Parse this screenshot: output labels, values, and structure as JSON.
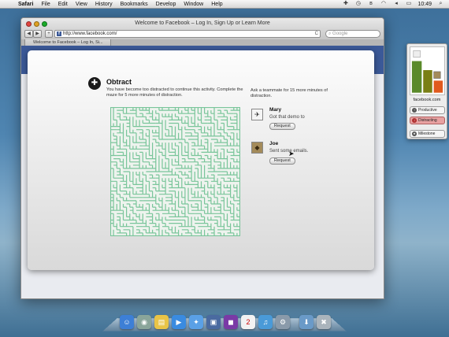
{
  "menubar": {
    "apple": "",
    "items": [
      "Safari",
      "File",
      "Edit",
      "View",
      "History",
      "Bookmarks",
      "Develop",
      "Window",
      "Help"
    ],
    "clock": "10:49"
  },
  "browser": {
    "window_title": "Welcome to Facebook – Log In, Sign Up or Learn More",
    "back": "◀",
    "forward": "▶",
    "add": "+",
    "url": "http://www.facebook.com/",
    "reload": "C",
    "search_placeholder": "Google",
    "tab_title": "Welcome to Facebook – Log In, Si..."
  },
  "obtract": {
    "title": "Obtract",
    "description": "You have become too distracted to continue this activity. Complete the maze for 5 more minutes of distraction.",
    "ask_text": "Ask a teammate for 15 more minutes of distraction.",
    "teammates": [
      {
        "name": "Mary",
        "status": "Got that demo to",
        "button": "Request"
      },
      {
        "name": "Joe",
        "status": "Sent some emails.",
        "button": "Request"
      }
    ]
  },
  "widget": {
    "site": "facebook.com",
    "buttons": [
      "Productive",
      "Distracting",
      "Milestone"
    ],
    "colors": {
      "productive": "#5a8a2a",
      "distracting": "#e05a1e",
      "olive": "#7a7f14"
    }
  },
  "colors": {
    "maze_wall": "#79c59a",
    "fb_blue": "#3b5998"
  }
}
